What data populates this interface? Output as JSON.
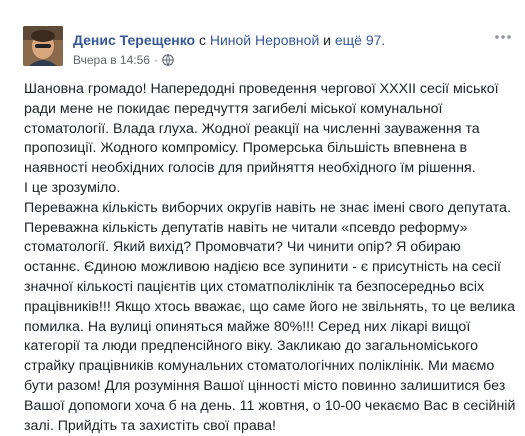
{
  "post": {
    "author": "Денис Терещенко",
    "with_word": "с",
    "tagged": "Ниной Неровной",
    "and_word": "и",
    "others": "ещё 97.",
    "timestamp": "Вчера в 14:56",
    "separator": "·",
    "paragraphs": [
      "Шановна громадо! Напередодні проведення чергової XXXII сесії міської ради мене не покидає передчуття загибелі міської комунальної стоматології. Влада глуха. Жодної реакції на численні зауваження та пропозиції. Жодного компромісу. Промерська більшість впевнена в наявності необхідних голосів для прийняття необхідного їм рішення.",
      "І це зрозуміло.",
      "Переважна кількість виборчих округів навіть не знає імені свого депутата.",
      "Переважна кількість депутатів навіть не читали «псевдо реформу» стоматології. Який вихід? Промовчати? Чи чинити опір? Я обираю останнє. Єдиною можливою надією все зупинити - є присутність на сесії значної кількості пацієнтів цих стоматполіклінік та безпосередньо всіх працівників!!! Якщо хтось вважає, що саме його не звільнять, то це велика помилка. На вулиці опиняться майже 80%!!! Серед них лікарі вищої категорії та люди предпенсійного віку. Закликаю до загальноміського страйку працівників комунальних стоматологічних поліклінік. Ми маємо бути разом! Для розуміння Вашої цінності місто повинно залишитися без Вашої допомоги хоча б на день. 11 жовтня, о 10-00 чекаємо Вас в сесійній залі. Прийдіть та захистіть свої права!"
    ]
  },
  "icons": {
    "globe": "globe-icon",
    "more": "more-horizontal-icon",
    "avatar": "profile-photo"
  },
  "colors": {
    "link": "#365899",
    "text": "#1d2129",
    "meta": "#616770"
  }
}
